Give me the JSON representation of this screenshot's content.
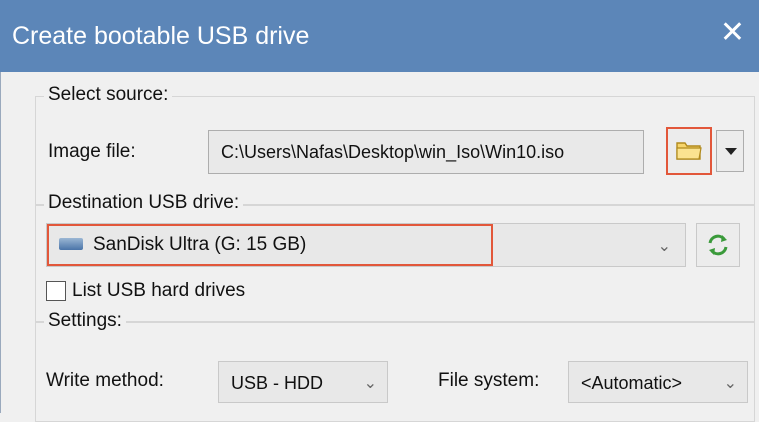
{
  "window": {
    "title": "Create bootable USB drive",
    "close_glyph": "✕"
  },
  "source": {
    "group_label": "Select source:",
    "image_label": "Image file:",
    "image_path": "C:\\Users\\Nafas\\Desktop\\win_Iso\\Win10.iso",
    "browse_icon": "folder-icon",
    "dropdown_icon": "triangle-down-icon"
  },
  "destination": {
    "group_label": "Destination USB drive:",
    "selected_drive": "SanDisk Ultra (G:  15 GB)",
    "drive_icon": "usb-drive-icon",
    "refresh_icon": "refresh-icon",
    "list_hdd_label": "List USB hard drives",
    "list_hdd_checked": false
  },
  "settings": {
    "group_label": "Settings:",
    "write_method_label": "Write method:",
    "write_method_value": "USB - HDD",
    "file_system_label": "File system:",
    "file_system_value": "<Automatic>"
  },
  "colors": {
    "titlebar": "#5c86b8",
    "highlight": "#e2573a"
  }
}
